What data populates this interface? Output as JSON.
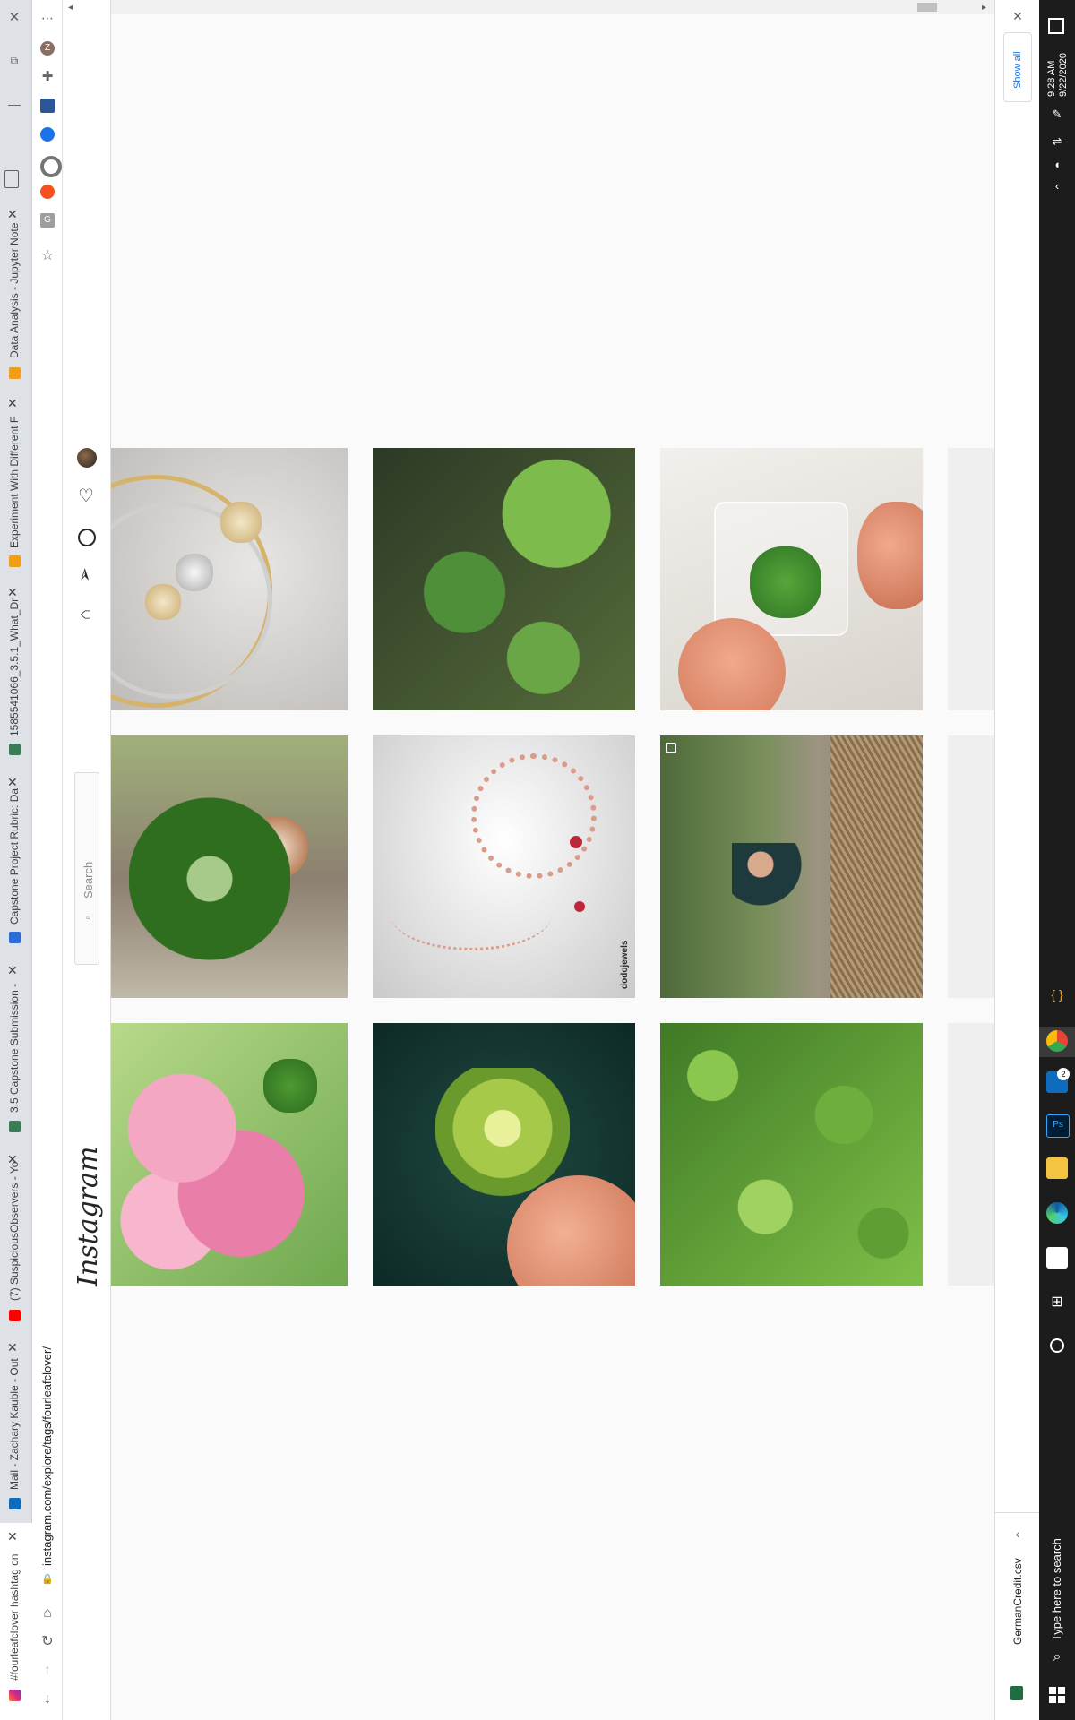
{
  "browser": {
    "tabs": [
      {
        "title": "#fourleafclover hashtag on",
        "favicon_color": "#e1306c"
      },
      {
        "title": "Mail - Zachary Kauble - Out",
        "favicon_color": "#0f6cbd"
      },
      {
        "title": "(7) SuspiciousObservers - Yo",
        "favicon_color": "#ff0000"
      },
      {
        "title": "3.5 Capstone Submission -",
        "favicon_color": "#3a7c55"
      },
      {
        "title": "Capstone Project Rubric: Da",
        "favicon_color": "#2d6bd6"
      },
      {
        "title": "1585541066_3.5.1_What_Dr",
        "favicon_color": "#3a7c55"
      },
      {
        "title": "Experiment With Different F",
        "favicon_color": "#f09d1a"
      },
      {
        "title": "Data Analysis - Jupyter Note",
        "favicon_color": "#f09d1a"
      }
    ],
    "address": "instagram.com/explore/tags/fourleafclover/",
    "extensions": [
      {
        "name": "profile-avatar",
        "label": "Z",
        "color": "#8d6e63"
      },
      {
        "name": "puzzle-extension",
        "color": "#5f6368"
      },
      {
        "name": "chart-extension",
        "color": "#2b5797"
      },
      {
        "name": "blue-extension",
        "color": "#1a73e8"
      },
      {
        "name": "gray-extension",
        "color": "#757575"
      },
      {
        "name": "orange-extension",
        "color": "#f4511e"
      },
      {
        "name": "g-extension",
        "label": "G",
        "color": "#9e9e9e"
      }
    ]
  },
  "instagram": {
    "logo": "Instagram",
    "search_placeholder": "Search"
  },
  "downloads": {
    "show_all": "Show all",
    "file": "GermanCredit.csv"
  },
  "taskbar": {
    "search_placeholder": "Type here to search",
    "time": "9:28 AM",
    "date": "9/22/2020",
    "mail_badge": "2"
  },
  "posts": [
    {
      "name": "bracelets-clover",
      "overlay": ""
    },
    {
      "name": "strawberry-clover",
      "overlay": ""
    },
    {
      "name": "clover-resin-pendant",
      "overlay": ""
    },
    {
      "name": "clover-dog",
      "overlay": ""
    },
    {
      "name": "dodojewels-jewelry",
      "overlay": "dodojewels"
    },
    {
      "name": "hiker-on-rock",
      "overlay": ""
    },
    {
      "name": "pink-flowers-clover",
      "overlay": ""
    },
    {
      "name": "clover-dark-background",
      "overlay": ""
    },
    {
      "name": "clover-field",
      "overlay": ""
    }
  ]
}
